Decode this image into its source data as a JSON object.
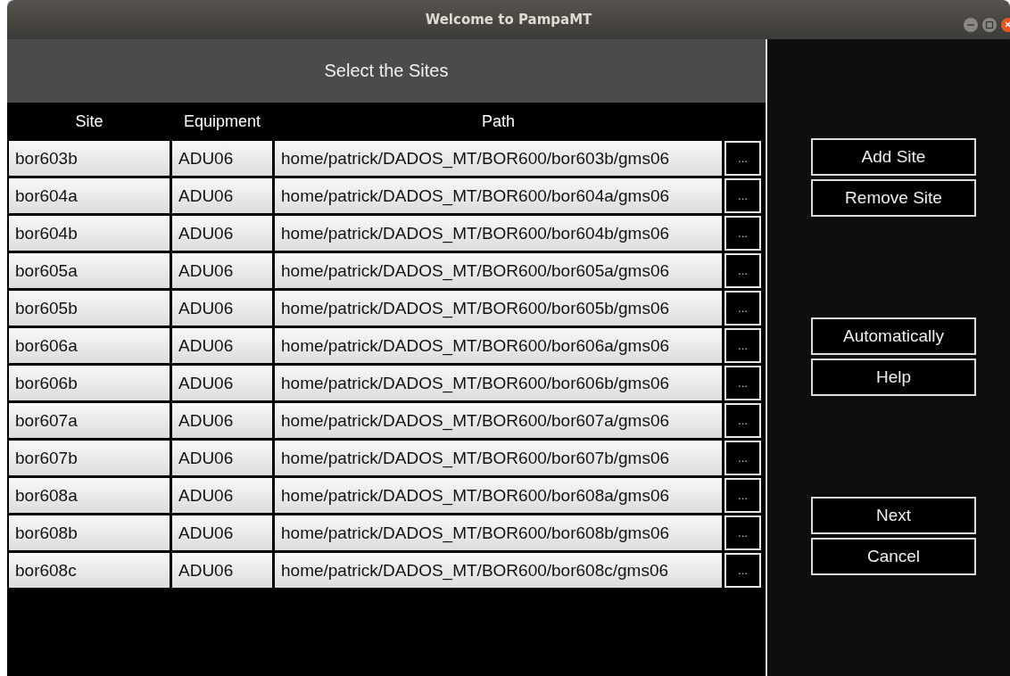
{
  "window": {
    "title": "Welcome to PampaMT"
  },
  "panel": {
    "title": "Select the Sites"
  },
  "table": {
    "columns": [
      "Site",
      "Equipment",
      "Path"
    ],
    "rows": [
      {
        "site": "bor603b",
        "equipment": "ADU06",
        "path": "home/patrick/DADOS_MT/BOR600/bor603b/gms06",
        "browse": "..."
      },
      {
        "site": "bor604a",
        "equipment": "ADU06",
        "path": "home/patrick/DADOS_MT/BOR600/bor604a/gms06",
        "browse": "..."
      },
      {
        "site": "bor604b",
        "equipment": "ADU06",
        "path": "home/patrick/DADOS_MT/BOR600/bor604b/gms06",
        "browse": "..."
      },
      {
        "site": "bor605a",
        "equipment": "ADU06",
        "path": "home/patrick/DADOS_MT/BOR600/bor605a/gms06",
        "browse": "..."
      },
      {
        "site": "bor605b",
        "equipment": "ADU06",
        "path": "home/patrick/DADOS_MT/BOR600/bor605b/gms06",
        "browse": "..."
      },
      {
        "site": "bor606a",
        "equipment": "ADU06",
        "path": "home/patrick/DADOS_MT/BOR600/bor606a/gms06",
        "browse": "..."
      },
      {
        "site": "bor606b",
        "equipment": "ADU06",
        "path": "home/patrick/DADOS_MT/BOR600/bor606b/gms06",
        "browse": "..."
      },
      {
        "site": "bor607a",
        "equipment": "ADU06",
        "path": "home/patrick/DADOS_MT/BOR600/bor607a/gms06",
        "browse": "..."
      },
      {
        "site": "bor607b",
        "equipment": "ADU06",
        "path": "home/patrick/DADOS_MT/BOR600/bor607b/gms06",
        "browse": "..."
      },
      {
        "site": "bor608a",
        "equipment": "ADU06",
        "path": "home/patrick/DADOS_MT/BOR600/bor608a/gms06",
        "browse": "..."
      },
      {
        "site": "bor608b",
        "equipment": "ADU06",
        "path": "home/patrick/DADOS_MT/BOR600/bor608b/gms06",
        "browse": "..."
      },
      {
        "site": "bor608c",
        "equipment": "ADU06",
        "path": "home/patrick/DADOS_MT/BOR600/bor608c/gms06",
        "browse": "..."
      }
    ]
  },
  "button_groups": [
    [
      "Add Site",
      "Remove Site"
    ],
    [
      "Automatically",
      "Help"
    ],
    [
      "Next",
      "Cancel"
    ]
  ]
}
